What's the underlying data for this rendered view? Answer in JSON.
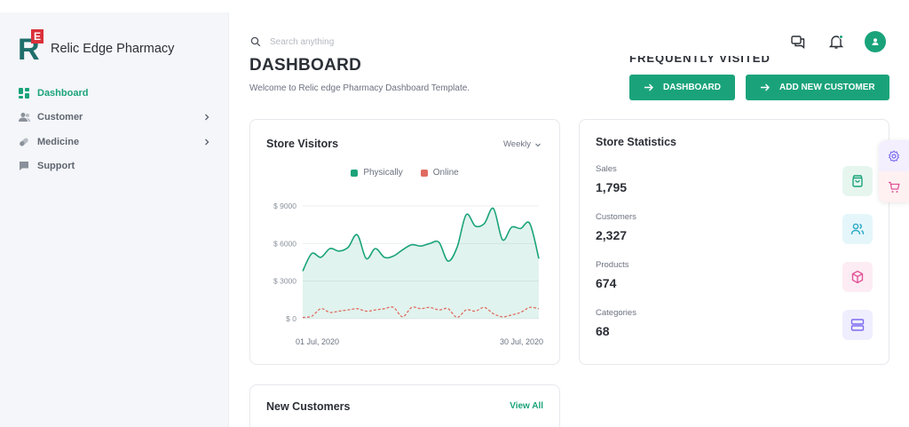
{
  "brand": {
    "logo_letter": "R",
    "logo_badge": "E",
    "name": "Relic Edge Pharmacy"
  },
  "sidebar": {
    "items": [
      {
        "label": "Dashboard",
        "icon": "grid-icon",
        "active": true,
        "has_submenu": false
      },
      {
        "label": "Customer",
        "icon": "users-icon",
        "active": false,
        "has_submenu": true
      },
      {
        "label": "Medicine",
        "icon": "pill-icon",
        "active": false,
        "has_submenu": true
      },
      {
        "label": "Support",
        "icon": "chat-bubble-icon",
        "active": false,
        "has_submenu": false
      }
    ]
  },
  "topbar": {
    "search_placeholder": "Search anything",
    "icons": [
      "chat-icon",
      "bell-icon",
      "user-avatar-icon"
    ]
  },
  "page": {
    "title": "DASHBOARD",
    "subtitle": "Welcome to Relic edge Pharmacy Dashboard Template.",
    "frequently_visited": "FREQUENTLY VISITED",
    "buttons": [
      {
        "label": "DASHBOARD",
        "icon": "arrow-right-icon"
      },
      {
        "label": "ADD NEW CUSTOMER",
        "icon": "arrow-right-icon"
      }
    ]
  },
  "visitors_card": {
    "title": "Store Visitors",
    "period": "Weekly",
    "legend": [
      {
        "label": "Physically",
        "color": "#1aa37a"
      },
      {
        "label": "Online",
        "color": "#e06c60"
      }
    ]
  },
  "chart_data": {
    "type": "area",
    "y_ticks": [
      "$ 0",
      "$ 3000",
      "$ 6000",
      "$ 9000"
    ],
    "ylim": [
      0,
      9000
    ],
    "x_labels": [
      "01 Jul, 2020",
      "30 Jul, 2020"
    ],
    "grid": true,
    "legend_position": "top-center",
    "series": [
      {
        "name": "Physically",
        "color": "#1aa37a",
        "values": [
          3800,
          5200,
          4900,
          5600,
          5400,
          5700,
          6700,
          4800,
          5600,
          4900,
          5000,
          5500,
          5900,
          5800,
          6000,
          6100,
          4600,
          5700,
          8300,
          7400,
          7600,
          8800,
          6300,
          7300,
          7200,
          7600,
          4800
        ]
      },
      {
        "name": "Online",
        "color": "#e06c60",
        "values": [
          100,
          200,
          800,
          500,
          600,
          700,
          800,
          600,
          700,
          800,
          900,
          150,
          900,
          800,
          900,
          700,
          800,
          100,
          700,
          600,
          900,
          400,
          150,
          300,
          500,
          900,
          800
        ]
      }
    ]
  },
  "stats_card": {
    "title": "Store Statistics",
    "items": [
      {
        "label": "Sales",
        "value": "1,795",
        "icon": "shopping-bag-icon",
        "bg": "#e6f6ef",
        "color": "#1aa37a"
      },
      {
        "label": "Customers",
        "value": "2,327",
        "icon": "users-icon",
        "bg": "#e5f6fb",
        "color": "#2aa8c4"
      },
      {
        "label": "Products",
        "value": "674",
        "icon": "box-icon",
        "bg": "#fdecf3",
        "color": "#e0539a"
      },
      {
        "label": "Categories",
        "value": "68",
        "icon": "server-icon",
        "bg": "#efeefe",
        "color": "#7b6cf0"
      }
    ]
  },
  "new_customers_card": {
    "title": "New Customers",
    "view_all": "View All"
  },
  "floating_panel": {
    "icons": [
      "settings-icon",
      "cart-icon"
    ]
  }
}
